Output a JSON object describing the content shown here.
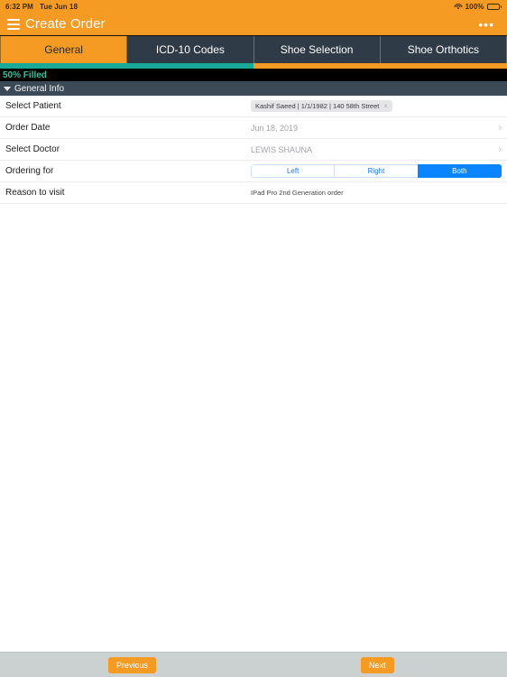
{
  "status_bar": {
    "time": "6:32 PM",
    "date": "Tue Jun 18",
    "battery_percent": "100%",
    "wifi_icon": "wifi-icon",
    "battery_icon": "battery-full-icon"
  },
  "nav": {
    "menu_icon": "hamburger-menu-icon",
    "title": "Create Order",
    "more_icon": "•••"
  },
  "tabs": [
    {
      "label": "General",
      "active": true
    },
    {
      "label": "ICD-10 Codes",
      "active": false
    },
    {
      "label": "Shoe Selection",
      "active": false
    },
    {
      "label": "Shoe Orthotics",
      "active": false
    }
  ],
  "progress": {
    "percent": 50,
    "filled_label": "50% Filled",
    "fill_color": "#18A999",
    "track_color": "#F59A22",
    "text_color": "#3BBF9C"
  },
  "section": {
    "title": "General Info",
    "caret_icon": "caret-down-icon",
    "expanded": true
  },
  "form": {
    "rows": [
      {
        "label": "Select Patient",
        "type": "chip",
        "chip_text": "Kashif Saeed | 1/1/1982 | 140 58th Street",
        "chip_remove_icon": "×"
      },
      {
        "label": "Order Date",
        "type": "value-chevron",
        "value": "Jun 18, 2019",
        "chevron_icon": "›"
      },
      {
        "label": "Select Doctor",
        "type": "value-chevron",
        "value": "LEWIS SHAUNA",
        "chevron_icon": "›"
      },
      {
        "label": "Ordering for",
        "type": "segmented",
        "options": [
          "Left",
          "Right",
          "Both"
        ],
        "selected": "Both"
      },
      {
        "label": "Reason to visit",
        "type": "text",
        "value": "IPad Pro 2nd Generation order"
      }
    ]
  },
  "toolbar": {
    "previous_label": "Previous",
    "next_label": "Next"
  },
  "colors": {
    "brand_orange": "#F59A22",
    "tab_dark": "#2F3B47",
    "section_dark": "#3C4A57",
    "teal": "#18A999",
    "ios_blue": "#0A84FF",
    "toolbar_gray": "#CBD0D1"
  }
}
